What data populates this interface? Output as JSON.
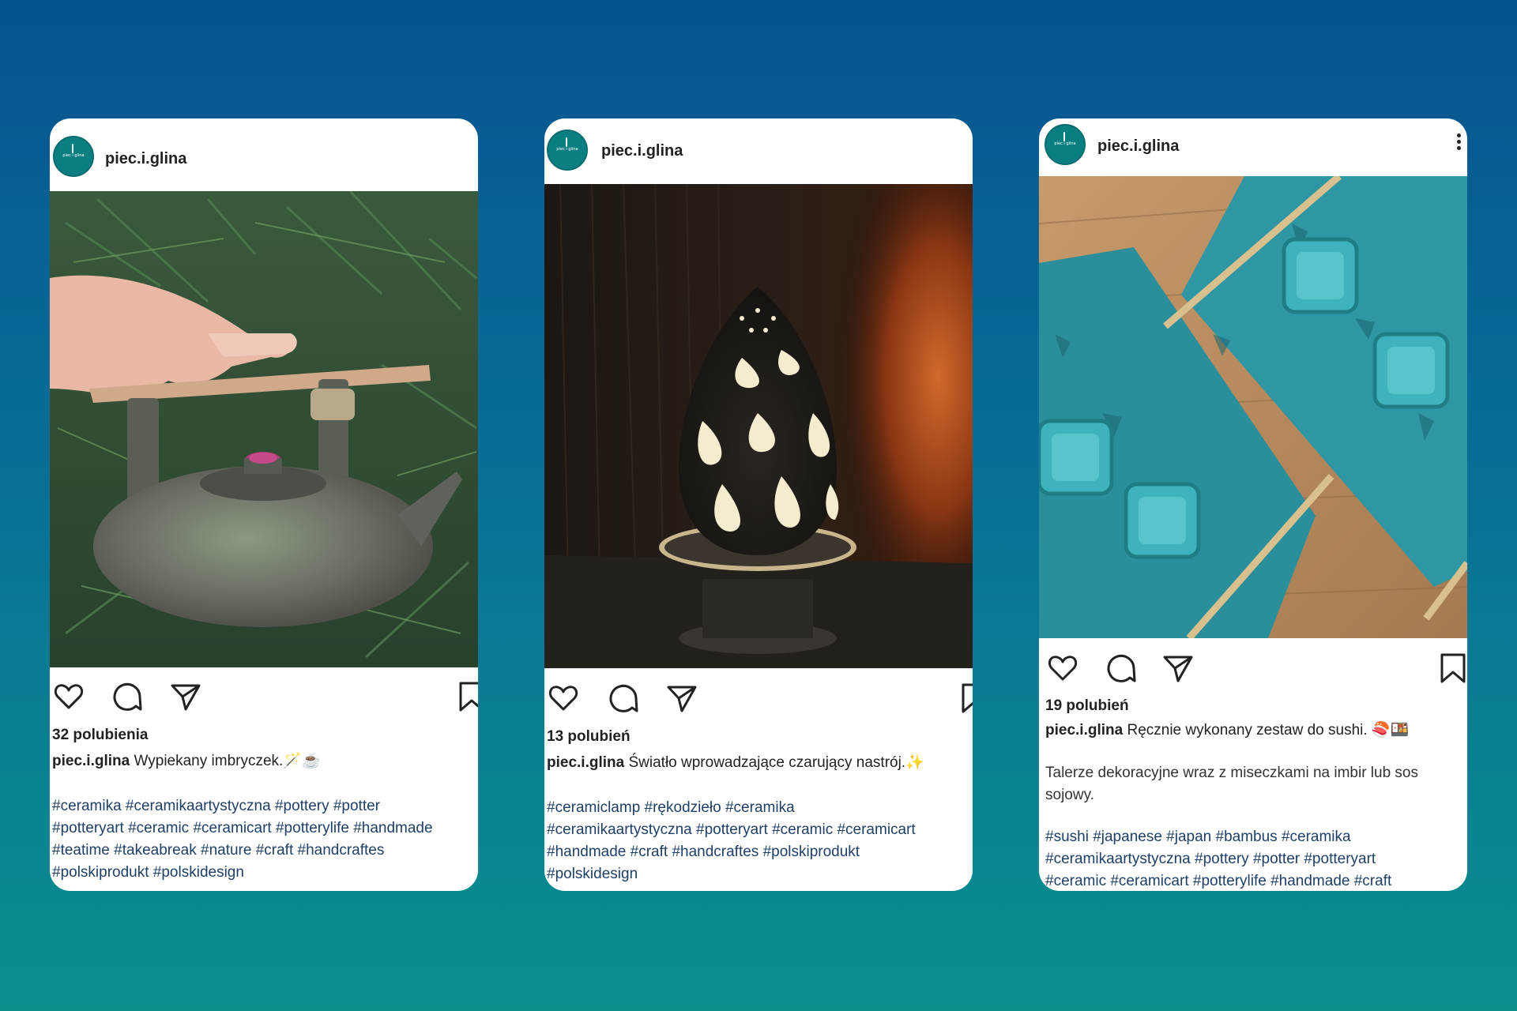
{
  "posts": [
    {
      "username": "piec.i.glina",
      "avatar_text": "piec i glina",
      "likes": "32 polubienia",
      "caption": "Wypiekany imbryczek.🪄☕",
      "body": "",
      "hashtags": [
        "#ceramika #ceramikaartystyczna #pottery #potter",
        "#potteryart #ceramic #ceramicart #potterylife #handmade",
        "#teatime #takeabreak #nature #craft #handcraftes",
        "#polskiprodukt #polskidesign"
      ],
      "photo_subject": "ceramic-teapot",
      "colors": {
        "primary": "#5f7a6d",
        "accent": "#b63a78"
      }
    },
    {
      "username": "piec.i.glina",
      "avatar_text": "piec i glina",
      "likes": "13 polubień",
      "caption": "Światło wprowadzające czarujący nastrój.✨",
      "body": "",
      "hashtags": [
        "#ceramiclamp #rękodzieło #ceramika",
        "#ceramikaartystyczna #potteryart #ceramic #ceramicart",
        "#handmade #craft #handcraftes #polskiprodukt",
        "#polskidesign"
      ],
      "photo_subject": "ceramic-lamp",
      "colors": {
        "primary": "#221b14",
        "accent": "#f2d27a"
      }
    },
    {
      "username": "piec.i.glina",
      "avatar_text": "piec i glina",
      "likes": "19 polubień",
      "caption": "Ręcznie wykonany zestaw do sushi. 🍣🍱",
      "body": "Talerze dekoracyjne wraz z miseczkami na imbir lub sos sojowy.",
      "hashtags": [
        "#sushi #japanese #japan #bambus #ceramika",
        "#ceramikaartystyczna #pottery #potter #potteryart",
        "#ceramic #ceramicart #potterylife #handmade #craft"
      ],
      "photo_subject": "sushi-set",
      "colors": {
        "primary": "#2c9aa6",
        "accent": "#b88a5a"
      }
    }
  ],
  "icons": [
    "heart-icon",
    "comment-icon",
    "share-icon",
    "bookmark-icon",
    "more-options-icon"
  ],
  "background": {
    "top": "#05538f",
    "bottom": "#0a8f8d"
  }
}
